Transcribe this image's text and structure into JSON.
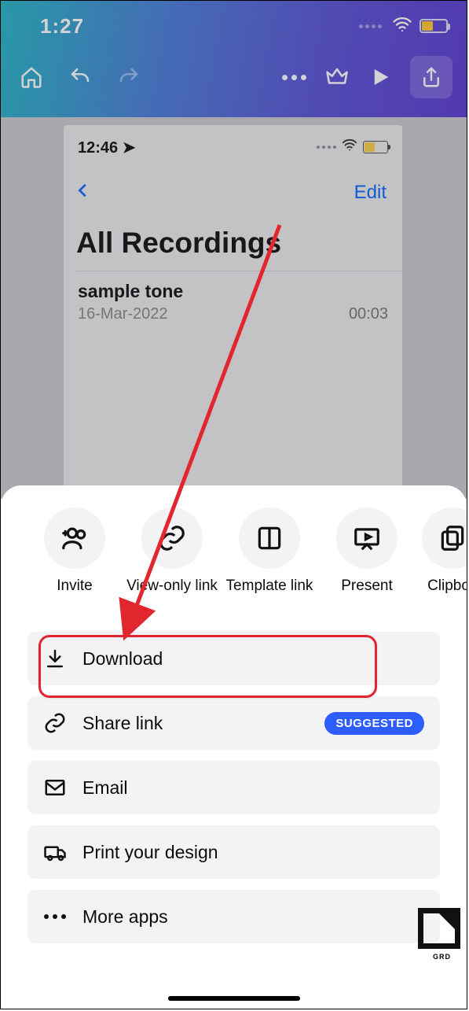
{
  "status": {
    "time": "1:27"
  },
  "preview": {
    "time": "12:46",
    "edit": "Edit",
    "title": "All Recordings",
    "item": {
      "name": "sample tone",
      "date": "16-Mar-2022",
      "duration": "00:03"
    }
  },
  "share_row": [
    {
      "label": "Invite"
    },
    {
      "label": "View-only link"
    },
    {
      "label": "Template link"
    },
    {
      "label": "Present"
    },
    {
      "label": "Clipbo"
    }
  ],
  "actions": {
    "download": "Download",
    "share_link": "Share link",
    "suggested": "SUGGESTED",
    "email": "Email",
    "print": "Print your design",
    "more_apps": "More apps"
  },
  "watermark": "GRD"
}
